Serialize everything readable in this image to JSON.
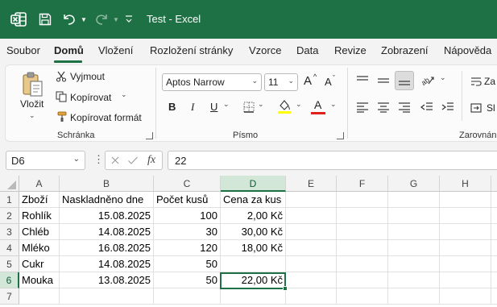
{
  "window": {
    "doc_title": "Test  -  Excel",
    "brand_color": "#1e7145"
  },
  "menu": {
    "items": [
      {
        "label": "Soubor"
      },
      {
        "label": "Domů",
        "active": true
      },
      {
        "label": "Vložení"
      },
      {
        "label": "Rozložení stránky"
      },
      {
        "label": "Vzorce"
      },
      {
        "label": "Data"
      },
      {
        "label": "Revize"
      },
      {
        "label": "Zobrazení"
      },
      {
        "label": "Nápověda"
      }
    ]
  },
  "ribbon": {
    "clipboard": {
      "paste_label": "Vložit",
      "cut_label": "Vyjmout",
      "copy_label": "Kopírovat",
      "format_painter_label": "Kopírovat formát",
      "group_label": "Schránka"
    },
    "font": {
      "font_name": "Aptos Narrow",
      "font_size": "11",
      "grow_label": "A",
      "shrink_label": "A",
      "bold_label": "B",
      "italic_label": "I",
      "underline_label": "U",
      "font_color_label": "A",
      "group_label": "Písmo",
      "highlight_color": "#ffff00",
      "font_color": "#e0201b"
    },
    "alignment": {
      "wrap_label": "Za",
      "merge_label": "Sl",
      "group_label": "Zarovnán"
    }
  },
  "formula_bar": {
    "name_box": "D6",
    "formula": "22",
    "fx_label": "fx"
  },
  "sheet": {
    "columns": [
      "A",
      "B",
      "C",
      "D",
      "E",
      "F",
      "G",
      "H"
    ],
    "selected_column": "D",
    "selected_row": "6",
    "rows": [
      {
        "num": "1",
        "cells": [
          "Zboží",
          "Naskladněno dne",
          "Počet kusů",
          "Cena za kus"
        ]
      },
      {
        "num": "2",
        "cells": [
          "Rohlík",
          "15.08.2025",
          "100",
          "2,00 Kč"
        ]
      },
      {
        "num": "3",
        "cells": [
          "Chléb",
          "14.08.2025",
          "30",
          "30,00 Kč"
        ]
      },
      {
        "num": "4",
        "cells": [
          "Mléko",
          "16.08.2025",
          "120",
          "18,00 Kč"
        ]
      },
      {
        "num": "5",
        "cells": [
          "Cukr",
          "14.08.2025",
          "50",
          ""
        ]
      },
      {
        "num": "6",
        "cells": [
          "Mouka",
          "13.08.2025",
          "50",
          "22,00 Kč"
        ]
      },
      {
        "num": "7",
        "cells": [
          "",
          "",
          "",
          ""
        ]
      }
    ]
  }
}
